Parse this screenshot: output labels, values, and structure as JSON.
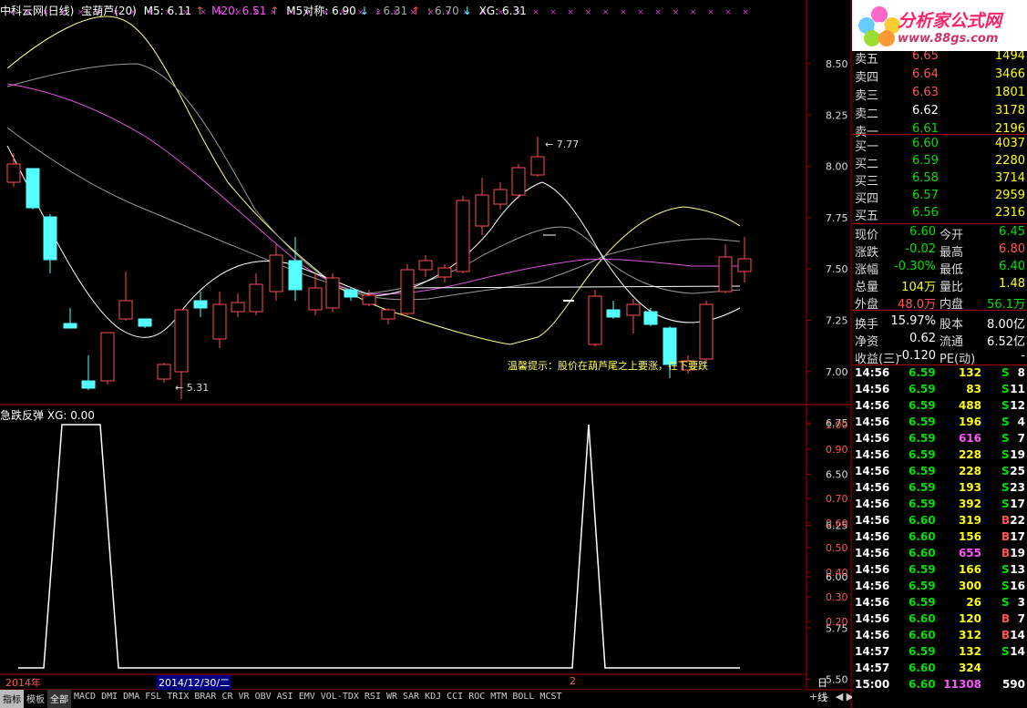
{
  "header": {
    "stock": "中科云网(日线)",
    "indicator": "宝葫芦(20)",
    "m5": "M5: 6.11",
    "m20": "M20: 6.51",
    "m5sym": "M5对称: 6.90",
    "v2": ": 6.31",
    "v3": ": 6.70",
    "xg": "XG: 6.31"
  },
  "price_axis": [
    "8.50",
    "8.25",
    "8.00",
    "7.75",
    "7.50",
    "7.25",
    "7.00",
    "6.75",
    "6.50",
    "6.25",
    "6.00",
    "5.75",
    "5.50"
  ],
  "ind_axis": [
    "1.00",
    "0.90",
    "0.70",
    "0.60",
    "0.50",
    "0.40",
    "0.30",
    "0.20"
  ],
  "annotations": {
    "high": "7.77",
    "low": "5.31"
  },
  "tip": "温馨提示：股价在葫芦尾之上要涨，在下要跌",
  "indicator_panel": {
    "name": "急跌反弹",
    "xg": "XG: 0.00"
  },
  "date_bar": {
    "year": "2014年",
    "date": "2014/12/30/二",
    "num": "2",
    "period": "日线"
  },
  "tabs": [
    "指标",
    "模板",
    "全部",
    "MACD",
    "DMI",
    "DMA",
    "FSL",
    "TRIX",
    "BRAR",
    "CR",
    "VR",
    "OBV",
    "ASI",
    "EMV",
    "VOL-TDX",
    "RSI",
    "WR",
    "SAR",
    "KDJ",
    "CCI",
    "ROC",
    "MTM",
    "BOLL",
    "MCST"
  ],
  "logo": {
    "brand": "分析家公式网",
    "url": "www.88gs.com"
  },
  "order_book": {
    "asks": [
      [
        "卖五",
        "6.65",
        "1494"
      ],
      [
        "卖四",
        "6.64",
        "3466"
      ],
      [
        "卖三",
        "6.63",
        "1801"
      ],
      [
        "卖二",
        "6.62",
        "3178"
      ],
      [
        "卖一",
        "6.61",
        "2196"
      ]
    ],
    "bids": [
      [
        "买一",
        "6.60",
        "4037"
      ],
      [
        "买二",
        "6.59",
        "2280"
      ],
      [
        "买三",
        "6.58",
        "3714"
      ],
      [
        "买四",
        "6.57",
        "2959"
      ],
      [
        "买五",
        "6.56",
        "2316"
      ]
    ]
  },
  "quote": [
    [
      "现价",
      "6.60",
      "今开",
      "6.45"
    ],
    [
      "涨跌",
      "-0.02",
      "最高",
      "6.80"
    ],
    [
      "涨幅",
      "-0.30%",
      "最低",
      "6.40"
    ],
    [
      "总量",
      "104万",
      "量比",
      "1.48"
    ],
    [
      "外盘",
      "48.0万",
      "内盘",
      "56.1万"
    ],
    [
      "换手",
      "15.97%",
      "股本",
      "8.00亿"
    ],
    [
      "净资",
      "0.62",
      "流通",
      "6.52亿"
    ],
    [
      "收益(三)",
      "-0.120",
      "PE(动)",
      "-"
    ]
  ],
  "ticks": [
    [
      "14:56",
      "6.59",
      "132",
      "S",
      "8"
    ],
    [
      "14:56",
      "6.59",
      "83",
      "S",
      "11"
    ],
    [
      "14:56",
      "6.59",
      "488",
      "S",
      "12"
    ],
    [
      "14:56",
      "6.59",
      "196",
      "S",
      "4"
    ],
    [
      "14:56",
      "6.59",
      "616",
      "S",
      "7"
    ],
    [
      "14:56",
      "6.59",
      "228",
      "S",
      "19"
    ],
    [
      "14:56",
      "6.59",
      "228",
      "S",
      "25"
    ],
    [
      "14:56",
      "6.59",
      "193",
      "S",
      "23"
    ],
    [
      "14:56",
      "6.59",
      "392",
      "S",
      "17"
    ],
    [
      "14:56",
      "6.60",
      "319",
      "B",
      "22"
    ],
    [
      "14:56",
      "6.60",
      "156",
      "B",
      "17"
    ],
    [
      "14:56",
      "6.60",
      "655",
      "B",
      "19"
    ],
    [
      "14:56",
      "6.59",
      "166",
      "S",
      "13"
    ],
    [
      "14:56",
      "6.59",
      "300",
      "S",
      "16"
    ],
    [
      "14:56",
      "6.59",
      "26",
      "S",
      "3"
    ],
    [
      "14:56",
      "6.60",
      "120",
      "B",
      "7"
    ],
    [
      "14:56",
      "6.60",
      "312",
      "B",
      "14"
    ],
    [
      "14:57",
      "6.59",
      "132",
      "S",
      "14"
    ],
    [
      "14:57",
      "6.60",
      "324",
      "",
      ""
    ],
    [
      "15:00",
      "6.60",
      "11308",
      "",
      "590"
    ]
  ]
}
